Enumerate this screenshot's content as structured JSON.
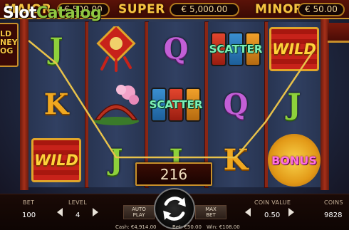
{
  "watermark": {
    "part1": "Slot",
    "part2": "Catalog"
  },
  "jackpots": {
    "major_label": "MAJOR",
    "major_value": "€ 500.00",
    "super_label": "SUPER",
    "super_value": "€ 5,000.00",
    "minor_label": "MINOR",
    "minor_value": "€ 50.00"
  },
  "logo_text": "LD\nNEY\nOG",
  "reels": {
    "col1": [
      "J",
      "K",
      "WILD"
    ],
    "col2": [
      "lantern",
      "bridge",
      "J"
    ],
    "col3": [
      "Q",
      "SCATTER",
      "J"
    ],
    "col4": [
      "SCATTER",
      "Q",
      "K"
    ],
    "col5": [
      "WILD",
      "J",
      "BONUS"
    ]
  },
  "symbol_labels": {
    "wild": "WILD",
    "scatter": "SCATTER",
    "bonus": "BONUS"
  },
  "win_amount": "216",
  "panel": {
    "bet_label": "BET",
    "bet_value": "100",
    "level_label": "LEVEL",
    "level_value": "4",
    "autoplay_label_1": "AUTO",
    "autoplay_label_2": "PLAY",
    "maxbet_label_1": "MAX",
    "maxbet_label_2": "BET",
    "coin_value_label": "COIN VALUE",
    "coin_value": "0.50",
    "coins_label": "COINS",
    "coins_value": "9828"
  },
  "status_bar": {
    "cash": "Cash: €4,914.00",
    "bet": "Bet: €50.00",
    "win": "Win: €108.00"
  },
  "colors": {
    "accent_gold": "#f5c542",
    "frame_red": "#8a2614",
    "win_line": "#e8c24a"
  },
  "icons": {
    "spin": "refresh-arrows-icon",
    "left_arrow": "triangle-left-icon",
    "right_arrow": "triangle-right-icon"
  }
}
